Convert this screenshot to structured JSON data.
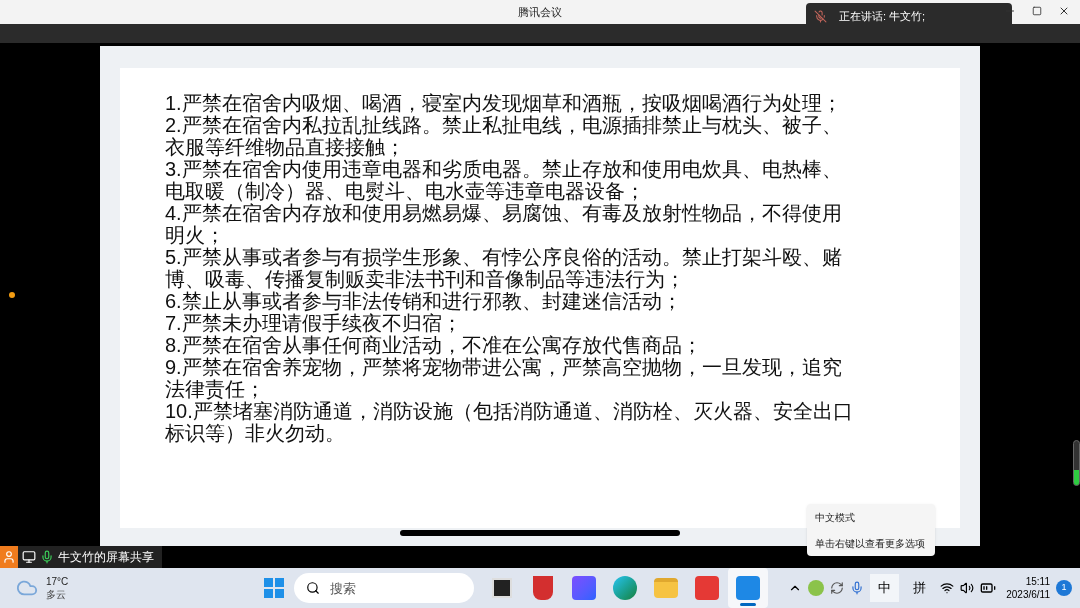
{
  "window": {
    "title": "腾讯会议"
  },
  "speaking": {
    "label": "正在讲话: 牛文竹;"
  },
  "slide": {
    "rules": [
      {
        "lines": [
          "1.严禁在宿舍内吸烟、喝酒，寝室内发现烟草和酒瓶，按吸烟喝酒行为处理；"
        ]
      },
      {
        "lines": [
          "2.严禁在宿舍内私拉乱扯线路。禁止私扯电线，电源插排禁止与枕头、被子、",
          "衣服等纤维物品直接接触；"
        ]
      },
      {
        "lines": [
          "3.严禁在宿舍内使用违章电器和劣质电器。禁止存放和使用电炊具、电热棒、",
          "电取暖（制冷）器、电熨斗、电水壶等违章电器设备；"
        ]
      },
      {
        "lines": [
          "4.严禁在宿舍内存放和使用易燃易爆、易腐蚀、有毒及放射性物品，不得使用",
          "明火；"
        ]
      },
      {
        "lines": [
          "5.严禁从事或者参与有损学生形象、有悖公序良俗的活动。禁止打架斗殴、赌",
          "博、吸毒、传播复制贩卖非法书刊和音像制品等违法行为；"
        ]
      },
      {
        "lines": [
          "6.禁止从事或者参与非法传销和进行邪教、封建迷信活动；"
        ]
      },
      {
        "lines": [
          "7.严禁未办理请假手续夜不归宿；"
        ]
      },
      {
        "lines": [
          "8.严禁在宿舍从事任何商业活动，不准在公寓存放代售商品；"
        ]
      },
      {
        "lines": [
          "9.严禁在宿舍养宠物，严禁将宠物带进公寓，严禁高空抛物，一旦发现，追究",
          "法律责任；"
        ]
      },
      {
        "lines": [
          "10.严禁堵塞消防通道，消防设施（包括消防通道、消防栓、灭火器、安全出口",
          "标识等）非火勿动。"
        ]
      }
    ]
  },
  "share_bar": {
    "label": "牛文竹的屏幕共享"
  },
  "tooltip": {
    "lines": [
      "中文模式",
      "单击右键以查看更多选项"
    ]
  },
  "taskbar": {
    "weather": {
      "temp": "17°C",
      "desc": "多云"
    },
    "search": {
      "placeholder": "搜索"
    },
    "apps": [
      {
        "kind": "taskview",
        "active": false
      },
      {
        "kind": "shield",
        "active": false
      },
      {
        "kind": "editor",
        "active": false
      },
      {
        "kind": "browser",
        "active": false
      },
      {
        "kind": "folder",
        "active": false
      },
      {
        "kind": "office",
        "active": false
      },
      {
        "kind": "meeting",
        "active": true
      }
    ],
    "ime": "中",
    "ime2": "拼",
    "time": "15:11",
    "date": "2023/6/11",
    "badge": "1"
  }
}
